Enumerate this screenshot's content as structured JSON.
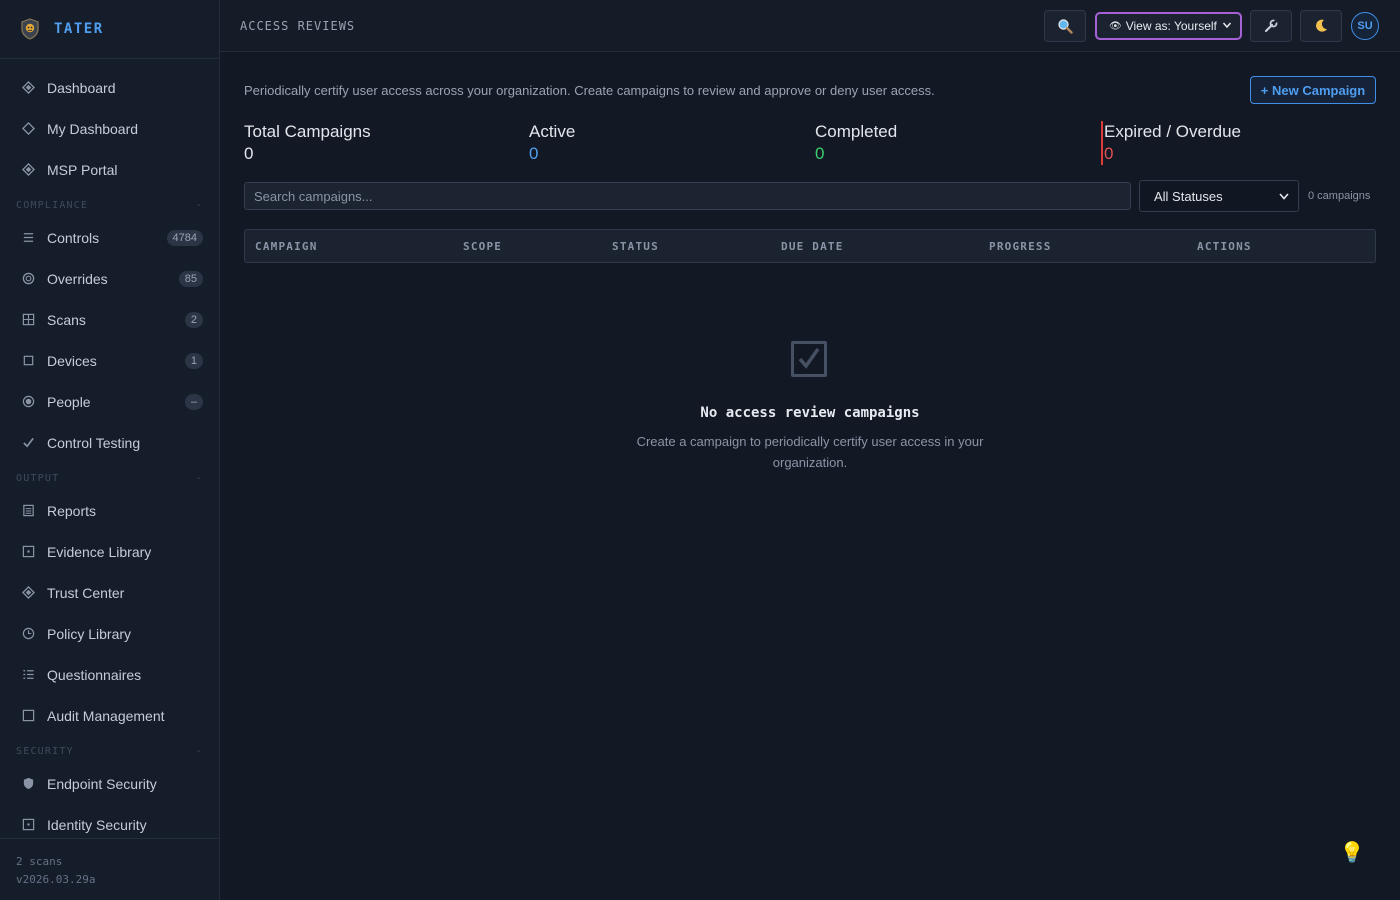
{
  "brand": {
    "name": "TATER"
  },
  "sidebar": {
    "items": [
      {
        "label": "Dashboard",
        "icon": "diamond-icon",
        "top": 0
      },
      {
        "label": "My Dashboard",
        "icon": "diamond-outline-icon"
      },
      {
        "label": "MSP Portal",
        "icon": "diamond-icon"
      }
    ],
    "sections": {
      "compliance": "COMPLIANCE",
      "output": "OUTPUT",
      "security": "SECURITY",
      "collapse_glyph": "-"
    },
    "compliance_items": [
      {
        "label": "Controls",
        "badge": "4784"
      },
      {
        "label": "Overrides",
        "badge": "85"
      },
      {
        "label": "Scans",
        "badge": "2"
      },
      {
        "label": "Devices",
        "badge": "1"
      },
      {
        "label": "People",
        "badge": "–"
      },
      {
        "label": "Control Testing"
      }
    ],
    "output_items": [
      {
        "label": "Reports"
      },
      {
        "label": "Evidence Library"
      },
      {
        "label": "Trust Center"
      },
      {
        "label": "Policy Library"
      },
      {
        "label": "Questionnaires"
      },
      {
        "label": "Audit Management"
      }
    ],
    "security_items": [
      {
        "label": "Endpoint Security"
      },
      {
        "label": "Identity Security"
      }
    ],
    "footer": {
      "scans": "2 scans",
      "version": "v2026.03.29a"
    }
  },
  "topbar": {
    "title": "ACCESS REVIEWS",
    "view_as": "View as: Yourself",
    "avatar_initials": "SU",
    "icons": {
      "search": "magnifier-icon",
      "tools": "wrench-icon",
      "theme": "moon-icon"
    }
  },
  "main": {
    "description": "Periodically certify user access across your organization. Create campaigns to review and approve or deny user access.",
    "new_campaign_label": "+ New Campaign",
    "stats": [
      {
        "label": "Total Campaigns",
        "value": "0",
        "color": "#e2e6ec"
      },
      {
        "label": "Active",
        "value": "0",
        "color": "#4f9ef0"
      },
      {
        "label": "Completed",
        "value": "0",
        "color": "#3ccf6e"
      },
      {
        "label": "Expired / Overdue",
        "value": "0",
        "color": "#e05252"
      }
    ],
    "search_placeholder": "Search campaigns...",
    "status_filter": "All Statuses",
    "count_label": "0 campaigns",
    "table_headers": [
      "CAMPAIGN",
      "SCOPE",
      "STATUS",
      "DUE DATE",
      "PROGRESS",
      "ACTIONS"
    ],
    "empty": {
      "title": "No access review campaigns",
      "text": "Create a campaign to periodically certify user access in your organization."
    }
  },
  "colors": {
    "accent": "#4f9ef0",
    "view_as_border": "#a661d6",
    "overdue_bar": "#e03b3b"
  }
}
